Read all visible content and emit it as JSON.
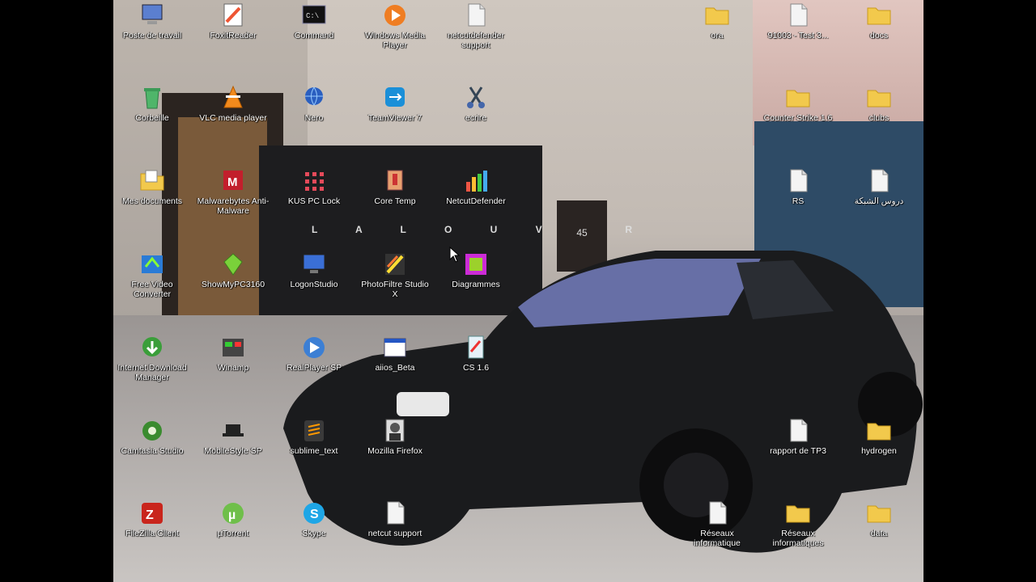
{
  "desktop": {
    "icons": [
      {
        "label": "Poste de travail",
        "icon": "computer-icon"
      },
      {
        "label": "FoxitReader",
        "icon": "pdf-reader-icon"
      },
      {
        "label": "Command",
        "icon": "terminal-icon"
      },
      {
        "label": "Windows Media Player",
        "icon": "media-player-icon"
      },
      {
        "label": "netcutdefender support",
        "icon": "document-icon"
      },
      {
        "label": "Corbeille",
        "icon": "recycle-bin-icon"
      },
      {
        "label": "VLC media player",
        "icon": "vlc-icon"
      },
      {
        "label": "Nero",
        "icon": "globe-icon"
      },
      {
        "label": "TeamViewer 7",
        "icon": "teamviewer-icon"
      },
      {
        "label": "ecrire",
        "icon": "scissors-icon"
      },
      {
        "label": "Mes documents",
        "icon": "folder-documents-icon"
      },
      {
        "label": "Malwarebytes Anti-Malware",
        "icon": "malwarebytes-icon"
      },
      {
        "label": "KUS PC Lock",
        "icon": "lock-grid-icon"
      },
      {
        "label": "Core Temp",
        "icon": "thermometer-icon"
      },
      {
        "label": "NetcutDefender",
        "icon": "bar-chart-icon"
      },
      {
        "label": "Free Video Converter",
        "icon": "video-converter-icon"
      },
      {
        "label": "ShowMyPC3160",
        "icon": "gem-icon"
      },
      {
        "label": "LogonStudio",
        "icon": "monitor-icon"
      },
      {
        "label": "PhotoFiltre Studio X",
        "icon": "photofiltre-icon"
      },
      {
        "label": "Diagrammes",
        "icon": "diagram-icon"
      },
      {
        "label": "Internet Download Manager",
        "icon": "download-manager-icon"
      },
      {
        "label": "Winamp",
        "icon": "winamp-icon"
      },
      {
        "label": "RealPlayer SP",
        "icon": "realplayer-icon"
      },
      {
        "label": "aiios_Beta",
        "icon": "window-icon"
      },
      {
        "label": "CS 1.6",
        "icon": "game-icon"
      },
      {
        "label": "Camtasia Studio",
        "icon": "camtasia-icon"
      },
      {
        "label": "MobileStyle SP",
        "icon": "hat-icon"
      },
      {
        "label": "sublime_text",
        "icon": "sublime-icon"
      },
      {
        "label": "Mozilla Firefox",
        "icon": "firefox-icon"
      },
      {
        "label": "FileZilla Client",
        "icon": "filezilla-icon"
      },
      {
        "label": "µTorrent",
        "icon": "utorrent-icon"
      },
      {
        "label": "Skype",
        "icon": "skype-icon"
      },
      {
        "label": "netcut support",
        "icon": "document-icon"
      },
      {
        "label": "ora",
        "icon": "folder-icon"
      },
      {
        "label": "91003 - Test 3...",
        "icon": "document-icon"
      },
      {
        "label": "docs",
        "icon": "folder-icon"
      },
      {
        "label": "Counter Strike 1.6",
        "icon": "folder-icon"
      },
      {
        "label": "clubs",
        "icon": "folder-icon"
      },
      {
        "label": "RS",
        "icon": "document-icon"
      },
      {
        "label": "دروس الشبكة",
        "icon": "document-icon"
      },
      {
        "label": "rapport de TP3",
        "icon": "document-icon"
      },
      {
        "label": "hydrogen",
        "icon": "folder-icon"
      },
      {
        "label": "Réseaux informatique",
        "icon": "document-icon"
      },
      {
        "label": "Réseaux informatiques",
        "icon": "folder-icon"
      },
      {
        "label": "data",
        "icon": "folder-icon"
      }
    ],
    "wallpaper": {
      "gate_text": "L A L O U V E R",
      "door_number": "45"
    }
  },
  "colors": {
    "folder": "#f2c94c",
    "label_text": "#ffffff",
    "letterbox": "#000000"
  }
}
